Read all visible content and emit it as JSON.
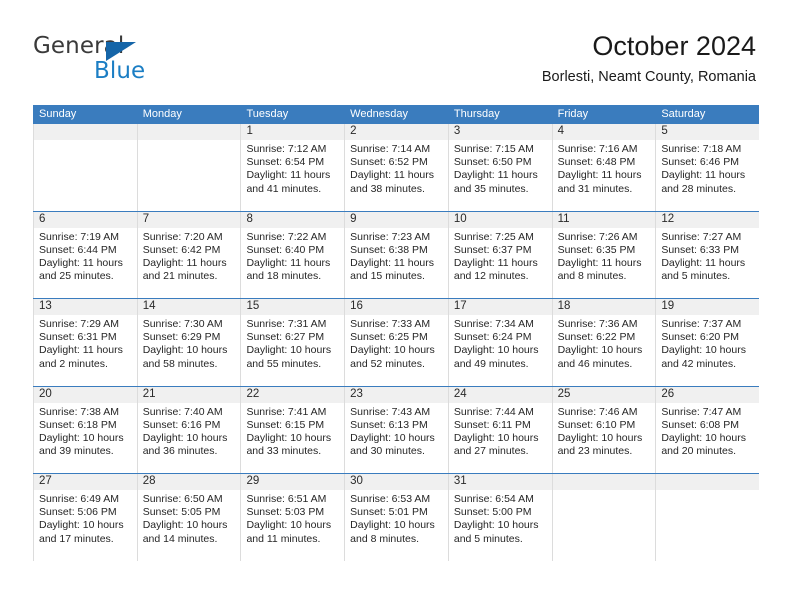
{
  "brand": {
    "name_part1": "General",
    "name_part2": "Blue",
    "triangle_icon": "triangle-logo-icon",
    "colors": {
      "dark": "#3a3a3a",
      "blue": "#1b7ec4",
      "triangle": "#1565a8"
    }
  },
  "header": {
    "title": "October 2024",
    "subtitle": "Borlesti, Neamt County, Romania"
  },
  "theme": {
    "header_row_blue": "#3a7cbe",
    "daynum_band": "#f0f0f0",
    "cell_border": "#dcdcdc"
  },
  "weekdays": [
    "Sunday",
    "Monday",
    "Tuesday",
    "Wednesday",
    "Thursday",
    "Friday",
    "Saturday"
  ],
  "weeks": [
    [
      {
        "day": "",
        "lines": [
          "",
          "",
          "",
          ""
        ],
        "empty": true
      },
      {
        "day": "",
        "lines": [
          "",
          "",
          "",
          ""
        ],
        "empty": true
      },
      {
        "day": "1",
        "lines": [
          "Sunrise: 7:12 AM",
          "Sunset: 6:54 PM",
          "Daylight: 11 hours",
          "and 41 minutes."
        ]
      },
      {
        "day": "2",
        "lines": [
          "Sunrise: 7:14 AM",
          "Sunset: 6:52 PM",
          "Daylight: 11 hours",
          "and 38 minutes."
        ]
      },
      {
        "day": "3",
        "lines": [
          "Sunrise: 7:15 AM",
          "Sunset: 6:50 PM",
          "Daylight: 11 hours",
          "and 35 minutes."
        ]
      },
      {
        "day": "4",
        "lines": [
          "Sunrise: 7:16 AM",
          "Sunset: 6:48 PM",
          "Daylight: 11 hours",
          "and 31 minutes."
        ]
      },
      {
        "day": "5",
        "lines": [
          "Sunrise: 7:18 AM",
          "Sunset: 6:46 PM",
          "Daylight: 11 hours",
          "and 28 minutes."
        ]
      }
    ],
    [
      {
        "day": "6",
        "lines": [
          "Sunrise: 7:19 AM",
          "Sunset: 6:44 PM",
          "Daylight: 11 hours",
          "and 25 minutes."
        ]
      },
      {
        "day": "7",
        "lines": [
          "Sunrise: 7:20 AM",
          "Sunset: 6:42 PM",
          "Daylight: 11 hours",
          "and 21 minutes."
        ]
      },
      {
        "day": "8",
        "lines": [
          "Sunrise: 7:22 AM",
          "Sunset: 6:40 PM",
          "Daylight: 11 hours",
          "and 18 minutes."
        ]
      },
      {
        "day": "9",
        "lines": [
          "Sunrise: 7:23 AM",
          "Sunset: 6:38 PM",
          "Daylight: 11 hours",
          "and 15 minutes."
        ]
      },
      {
        "day": "10",
        "lines": [
          "Sunrise: 7:25 AM",
          "Sunset: 6:37 PM",
          "Daylight: 11 hours",
          "and 12 minutes."
        ]
      },
      {
        "day": "11",
        "lines": [
          "Sunrise: 7:26 AM",
          "Sunset: 6:35 PM",
          "Daylight: 11 hours",
          "and 8 minutes."
        ]
      },
      {
        "day": "12",
        "lines": [
          "Sunrise: 7:27 AM",
          "Sunset: 6:33 PM",
          "Daylight: 11 hours",
          "and 5 minutes."
        ]
      }
    ],
    [
      {
        "day": "13",
        "lines": [
          "Sunrise: 7:29 AM",
          "Sunset: 6:31 PM",
          "Daylight: 11 hours",
          "and 2 minutes."
        ]
      },
      {
        "day": "14",
        "lines": [
          "Sunrise: 7:30 AM",
          "Sunset: 6:29 PM",
          "Daylight: 10 hours",
          "and 58 minutes."
        ]
      },
      {
        "day": "15",
        "lines": [
          "Sunrise: 7:31 AM",
          "Sunset: 6:27 PM",
          "Daylight: 10 hours",
          "and 55 minutes."
        ]
      },
      {
        "day": "16",
        "lines": [
          "Sunrise: 7:33 AM",
          "Sunset: 6:25 PM",
          "Daylight: 10 hours",
          "and 52 minutes."
        ]
      },
      {
        "day": "17",
        "lines": [
          "Sunrise: 7:34 AM",
          "Sunset: 6:24 PM",
          "Daylight: 10 hours",
          "and 49 minutes."
        ]
      },
      {
        "day": "18",
        "lines": [
          "Sunrise: 7:36 AM",
          "Sunset: 6:22 PM",
          "Daylight: 10 hours",
          "and 46 minutes."
        ]
      },
      {
        "day": "19",
        "lines": [
          "Sunrise: 7:37 AM",
          "Sunset: 6:20 PM",
          "Daylight: 10 hours",
          "and 42 minutes."
        ]
      }
    ],
    [
      {
        "day": "20",
        "lines": [
          "Sunrise: 7:38 AM",
          "Sunset: 6:18 PM",
          "Daylight: 10 hours",
          "and 39 minutes."
        ]
      },
      {
        "day": "21",
        "lines": [
          "Sunrise: 7:40 AM",
          "Sunset: 6:16 PM",
          "Daylight: 10 hours",
          "and 36 minutes."
        ]
      },
      {
        "day": "22",
        "lines": [
          "Sunrise: 7:41 AM",
          "Sunset: 6:15 PM",
          "Daylight: 10 hours",
          "and 33 minutes."
        ]
      },
      {
        "day": "23",
        "lines": [
          "Sunrise: 7:43 AM",
          "Sunset: 6:13 PM",
          "Daylight: 10 hours",
          "and 30 minutes."
        ]
      },
      {
        "day": "24",
        "lines": [
          "Sunrise: 7:44 AM",
          "Sunset: 6:11 PM",
          "Daylight: 10 hours",
          "and 27 minutes."
        ]
      },
      {
        "day": "25",
        "lines": [
          "Sunrise: 7:46 AM",
          "Sunset: 6:10 PM",
          "Daylight: 10 hours",
          "and 23 minutes."
        ]
      },
      {
        "day": "26",
        "lines": [
          "Sunrise: 7:47 AM",
          "Sunset: 6:08 PM",
          "Daylight: 10 hours",
          "and 20 minutes."
        ]
      }
    ],
    [
      {
        "day": "27",
        "lines": [
          "Sunrise: 6:49 AM",
          "Sunset: 5:06 PM",
          "Daylight: 10 hours",
          "and 17 minutes."
        ]
      },
      {
        "day": "28",
        "lines": [
          "Sunrise: 6:50 AM",
          "Sunset: 5:05 PM",
          "Daylight: 10 hours",
          "and 14 minutes."
        ]
      },
      {
        "day": "29",
        "lines": [
          "Sunrise: 6:51 AM",
          "Sunset: 5:03 PM",
          "Daylight: 10 hours",
          "and 11 minutes."
        ]
      },
      {
        "day": "30",
        "lines": [
          "Sunrise: 6:53 AM",
          "Sunset: 5:01 PM",
          "Daylight: 10 hours",
          "and 8 minutes."
        ]
      },
      {
        "day": "31",
        "lines": [
          "Sunrise: 6:54 AM",
          "Sunset: 5:00 PM",
          "Daylight: 10 hours",
          "and 5 minutes."
        ]
      },
      {
        "day": "",
        "lines": [
          "",
          "",
          "",
          ""
        ],
        "empty": true
      },
      {
        "day": "",
        "lines": [
          "",
          "",
          "",
          ""
        ],
        "empty": true
      }
    ]
  ]
}
